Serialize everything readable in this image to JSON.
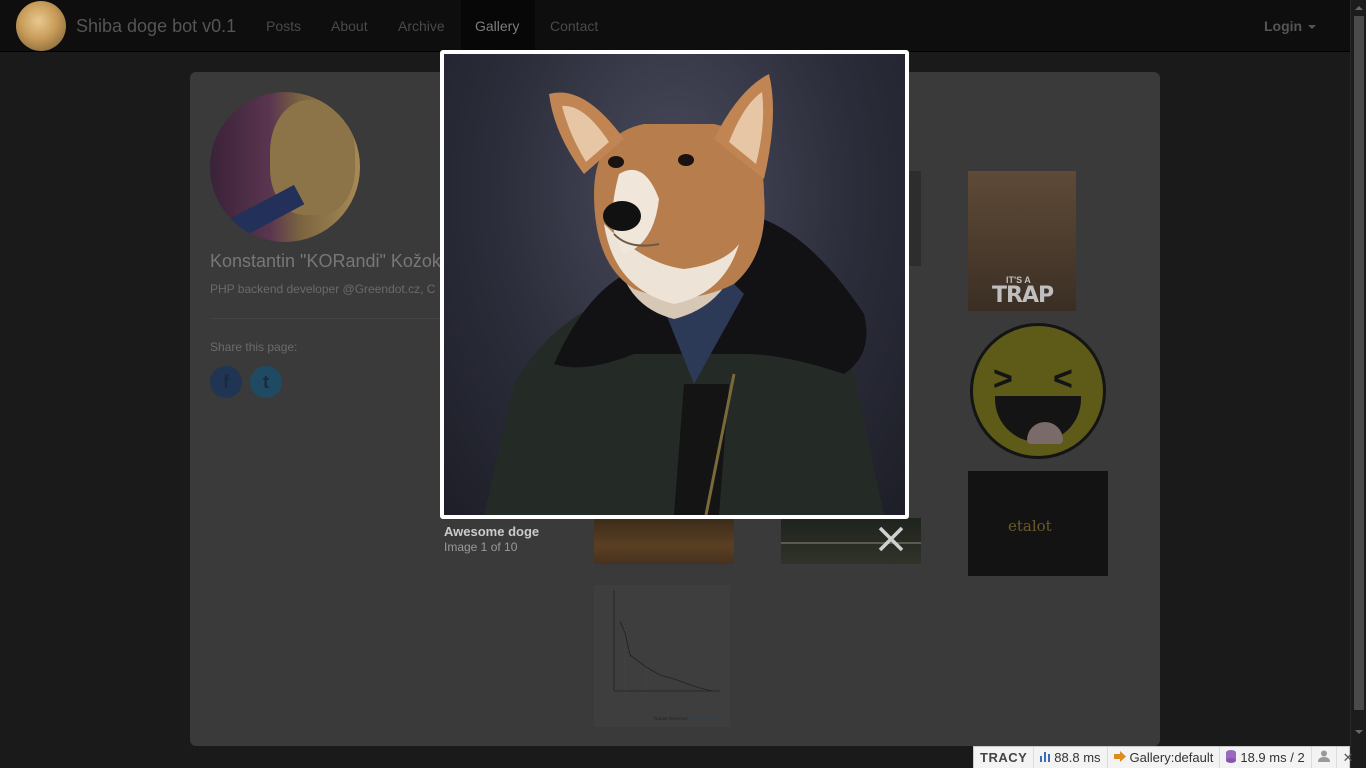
{
  "navbar": {
    "brand": "Shiba doge bot v0.1",
    "items": [
      {
        "label": "Posts"
      },
      {
        "label": "About"
      },
      {
        "label": "Archive"
      },
      {
        "label": "Gallery"
      },
      {
        "label": "Contact"
      }
    ],
    "active": "Gallery",
    "login_label": "Login"
  },
  "profile": {
    "name": "Konstantin \"KORandi\" Kožok",
    "description": "PHP backend developer @Greendot.cz, C",
    "share_label": "Share this page:",
    "share_buttons": [
      {
        "icon": "facebook-icon",
        "glyph": "f"
      },
      {
        "icon": "twitter-icon",
        "glyph": "t"
      }
    ]
  },
  "gallery": {
    "thumb_trap_line1": "IT'S A",
    "thumb_trap_line2": "TRAP",
    "thumb_etalot_text": "etalot",
    "thumb_chart_footer": "Nature Reviews",
    "thumb_chart_footer_link": "Neuroscience"
  },
  "lightbox": {
    "caption": "Awesome doge",
    "counter": "Image 1 of 10",
    "close_icon": "close-icon"
  },
  "tracy": {
    "logo": "TRACY",
    "time": "88.8 ms",
    "presenter": "Gallery:default",
    "db": "18.9 ms / 2"
  },
  "colors": {
    "overlay_bg": "#1a1a1a",
    "frame": "#ffffff",
    "navbar_bg": "#0e0e0e"
  }
}
